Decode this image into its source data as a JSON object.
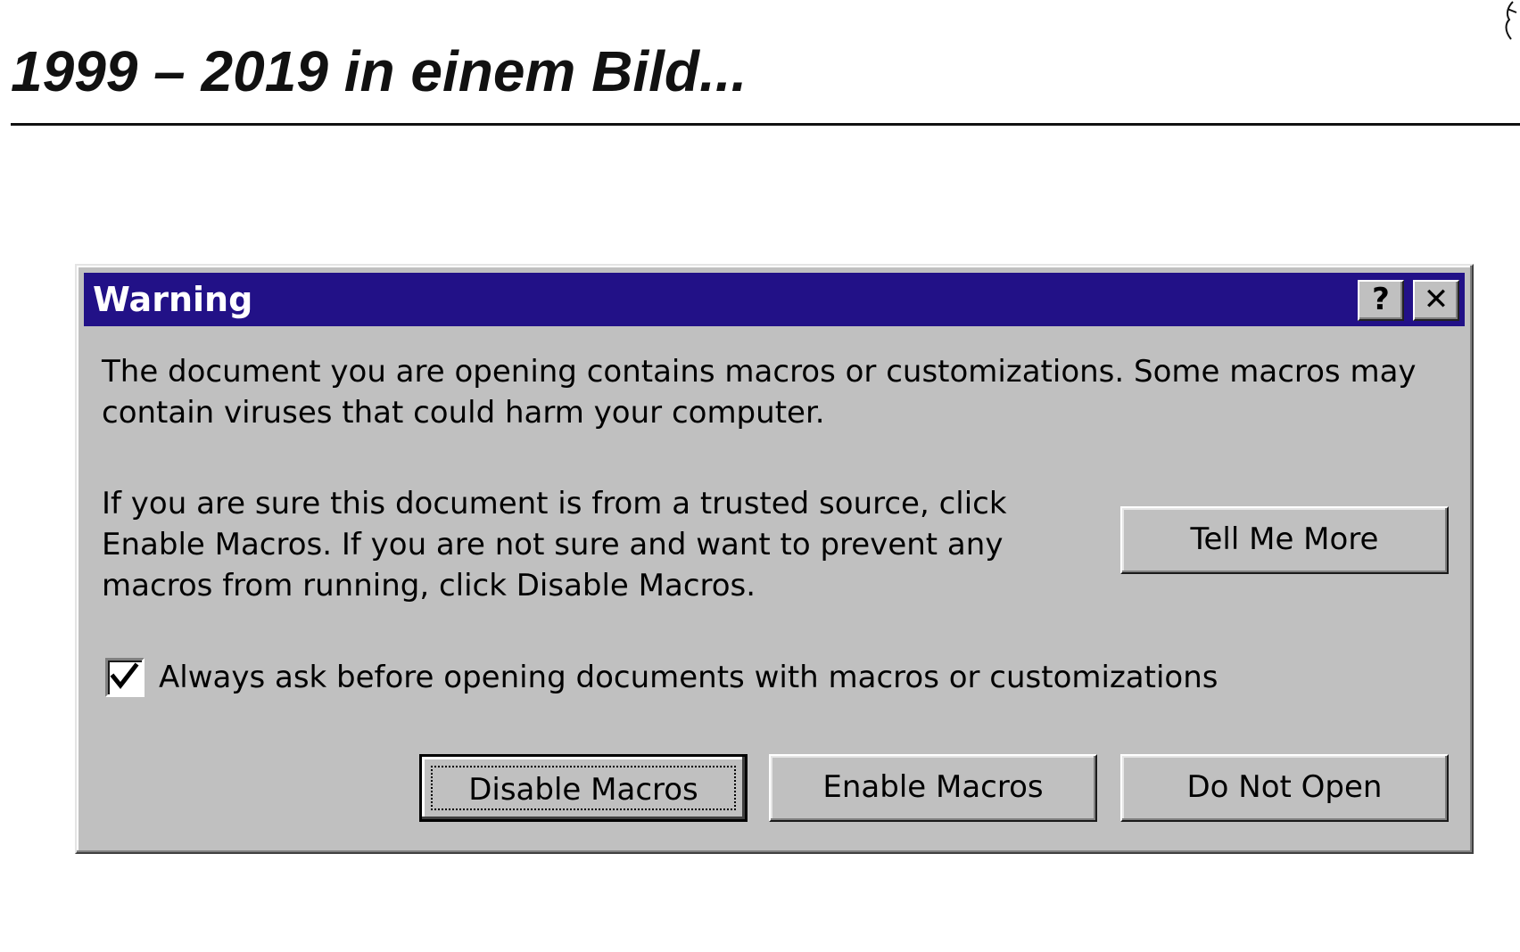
{
  "slide": {
    "title": "1999 – 2019 in einem Bild..."
  },
  "dialog": {
    "title": "Warning",
    "help_label": "?",
    "close_label": "✕",
    "message_1": "The document you are opening contains macros or customizations. Some macros may contain viruses that could harm your computer.",
    "message_2": "If you are sure this document is from a trusted source, click Enable Macros. If you are not sure and want to prevent any macros from running, click Disable Macros.",
    "tell_me_more_label": "Tell Me More",
    "checkbox": {
      "label": "Always ask before opening documents with macros or customizations",
      "checked": true
    },
    "buttons": {
      "disable": "Disable Macros",
      "enable": "Enable Macros",
      "do_not_open": "Do Not Open"
    }
  },
  "colors": {
    "titlebar": "#221187",
    "dialog_face": "#c0c0c0"
  }
}
